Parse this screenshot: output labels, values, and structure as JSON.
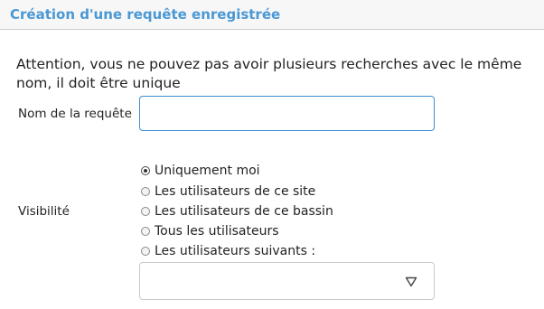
{
  "dialog": {
    "title": "Création d'une requête enregistrée"
  },
  "warning": "Attention, vous ne pouvez pas avoir plusieurs recherches avec le même nom, il doit être unique",
  "name_field": {
    "label": "Nom de la requête",
    "value": "",
    "placeholder": ""
  },
  "visibility": {
    "label": "Visibilité",
    "options": [
      {
        "label": "Uniquement moi",
        "checked": true
      },
      {
        "label": "Les utilisateurs de ce site",
        "checked": false
      },
      {
        "label": "Les utilisateurs de ce bassin",
        "checked": false
      },
      {
        "label": "Tous les utilisateurs",
        "checked": false
      },
      {
        "label": "Les utilisateurs suivants :",
        "checked": false
      }
    ]
  },
  "users_select": {
    "value": "",
    "icon": "chevron-down-icon"
  },
  "colors": {
    "title": "#4a98d4",
    "input_focus_border": "#3d8ed0"
  }
}
